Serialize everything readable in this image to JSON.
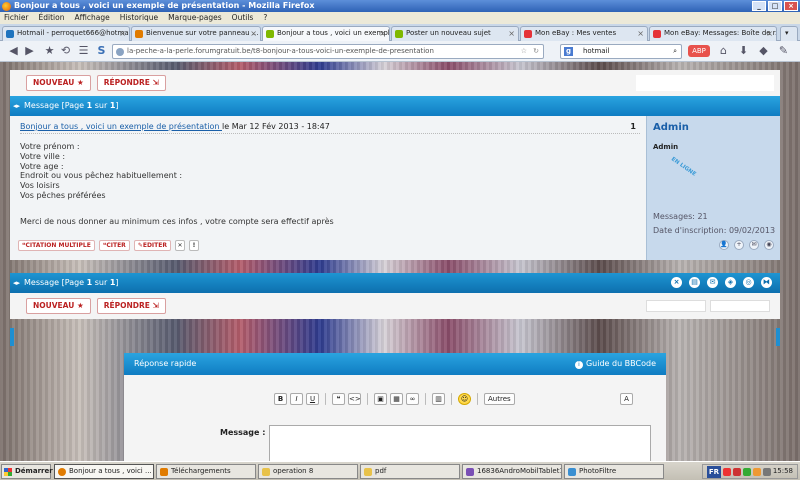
{
  "window": {
    "title": "Bonjour a tous , voici un exemple de présentation - Mozilla Firefox"
  },
  "menu": [
    "Fichier",
    "Édition",
    "Affichage",
    "Historique",
    "Marque-pages",
    "Outils",
    "?"
  ],
  "tabs": [
    {
      "label": "Hotmail - perroquet666@hotmail...",
      "active": false,
      "icon_color": "#1e73be"
    },
    {
      "label": "Bienvenue sur votre panneau ...",
      "active": false,
      "icon_color": "#e07b00"
    },
    {
      "label": "Bonjour a tous , voici un exempl...",
      "active": true,
      "icon_color": "#7fb800"
    },
    {
      "label": "Poster un nouveau sujet",
      "active": false,
      "icon_color": "#7fb800"
    },
    {
      "label": "Mon eBay : Mes ventes",
      "active": false,
      "icon_color": "#e53238"
    },
    {
      "label": "Mon eBay: Messages: Boîte de r...",
      "active": false,
      "icon_color": "#e53238"
    }
  ],
  "nav": {
    "url": "la-peche-a-la-perle.forumgratuit.be/t8-bonjour-a-tous-voici-un-exemple-de-presentation",
    "search_engine": "g",
    "search_value": "hotmail"
  },
  "forum": {
    "new_label": "NOUVEAU",
    "reply_label": "RÉPONDRE",
    "message_bar_prefix": "Message [Page ",
    "page_current": "1",
    "page_sep": " sur ",
    "page_total": "1",
    "page_close": "]"
  },
  "post": {
    "title": "Bonjour a tous , voici un exemple de présentation ",
    "date": "le Mar 12 Fév 2013 - 18:47",
    "number": "1",
    "lines": [
      "Votre prénom :",
      "Votre ville :",
      "Votre age :",
      "Endroit ou vous pêchez habituellement :",
      "Vos loisirs",
      "Vos pêches préférées"
    ],
    "note": "Merci de nous donner au minimum ces infos , votre compte sera effectif après",
    "actions": [
      "CITATION MULTIPLE",
      "CITER",
      "EDITER"
    ],
    "author": {
      "name": "Admin",
      "rank": "Admin",
      "online": "EN LIGNE",
      "messages": "Messages: 21",
      "joined": "Date d'inscription: 09/02/2013"
    }
  },
  "quick_reply": {
    "title": "Réponse rapide",
    "guide": "Guide du BBCode",
    "toolbar_more": "Autres",
    "message_label": "Message :"
  },
  "taskbar": {
    "start": "Démarrer",
    "tasks": [
      {
        "label": "Bonjour a tous , voici ...",
        "active": true,
        "icon_color": "#e07b00"
      },
      {
        "label": "Téléchargements",
        "active": false,
        "icon_color": "#e07b00"
      },
      {
        "label": "operation 8",
        "active": false,
        "icon_color": "#e8c24a"
      },
      {
        "label": "pdf",
        "active": false,
        "icon_color": "#e8c24a"
      },
      {
        "label": "16836AndroMobilTablet1...",
        "active": false,
        "icon_color": "#7a4fb5"
      },
      {
        "label": "PhotoFiltre",
        "active": false,
        "icon_color": "#3a8fd1"
      }
    ],
    "lang": "FR",
    "time": "15:58"
  }
}
